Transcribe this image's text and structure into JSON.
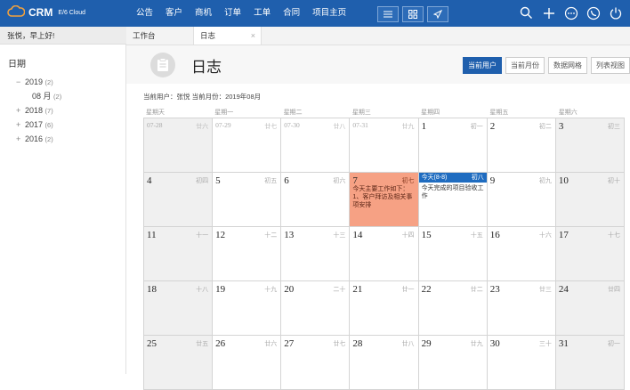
{
  "app": {
    "brand": "CRM",
    "sub": "E/6 Cloud"
  },
  "nav": [
    "公告",
    "客户",
    "商机",
    "订单",
    "工单",
    "合同",
    "项目主页"
  ],
  "greeting": "张悦，早上好!",
  "sidebar": {
    "title": "日期",
    "tree": [
      {
        "toggle": "−",
        "label": "2019",
        "count": "(2)",
        "child": false
      },
      {
        "toggle": "",
        "label": "08 月",
        "count": "(2)",
        "child": true
      },
      {
        "toggle": "+",
        "label": "2018",
        "count": "(7)",
        "child": false
      },
      {
        "toggle": "+",
        "label": "2017",
        "count": "(6)",
        "child": false
      },
      {
        "toggle": "+",
        "label": "2016",
        "count": "(2)",
        "child": false
      }
    ]
  },
  "tabs": {
    "workbench": "工作台",
    "log": "日志",
    "close": "×"
  },
  "page": {
    "title": "日志"
  },
  "view_buttons": [
    "当前用户",
    "当前月份",
    "数据网格",
    "列表视图"
  ],
  "status": "当前用户：张悦  当前月份：2019年08月",
  "weekdays": [
    "星期天",
    "星期一",
    "星期二",
    "星期三",
    "星期四",
    "星期五",
    "星期六"
  ],
  "days": [
    {
      "d": "07-28",
      "l": "廿六",
      "o": true,
      "w": true
    },
    {
      "d": "07-29",
      "l": "廿七",
      "o": true
    },
    {
      "d": "07-30",
      "l": "廿八",
      "o": true
    },
    {
      "d": "07-31",
      "l": "廿九",
      "o": true
    },
    {
      "d": "1",
      "l": "初一"
    },
    {
      "d": "2",
      "l": "初二"
    },
    {
      "d": "3",
      "l": "初三",
      "w": true
    },
    {
      "d": "4",
      "l": "初四",
      "w": true
    },
    {
      "d": "5",
      "l": "初五"
    },
    {
      "d": "6",
      "l": "初六"
    },
    {
      "d": "7",
      "l": "初七",
      "h": true,
      "note": "今天主要工作如下：1、客户拜访及相关事项安排"
    },
    {
      "d": "今天(8-8)",
      "l": "初八",
      "today": true,
      "note": "今天完成的项目验收工作"
    },
    {
      "d": "9",
      "l": "初九"
    },
    {
      "d": "10",
      "l": "初十",
      "w": true
    },
    {
      "d": "11",
      "l": "十一",
      "w": true
    },
    {
      "d": "12",
      "l": "十二"
    },
    {
      "d": "13",
      "l": "十三"
    },
    {
      "d": "14",
      "l": "十四"
    },
    {
      "d": "15",
      "l": "十五"
    },
    {
      "d": "16",
      "l": "十六"
    },
    {
      "d": "17",
      "l": "十七",
      "w": true
    },
    {
      "d": "18",
      "l": "十八",
      "w": true
    },
    {
      "d": "19",
      "l": "十九"
    },
    {
      "d": "20",
      "l": "二十"
    },
    {
      "d": "21",
      "l": "廿一"
    },
    {
      "d": "22",
      "l": "廿二"
    },
    {
      "d": "23",
      "l": "廿三"
    },
    {
      "d": "24",
      "l": "廿四",
      "w": true
    },
    {
      "d": "25",
      "l": "廿五",
      "w": true
    },
    {
      "d": "26",
      "l": "廿六"
    },
    {
      "d": "27",
      "l": "廿七"
    },
    {
      "d": "28",
      "l": "廿八"
    },
    {
      "d": "29",
      "l": "廿九"
    },
    {
      "d": "30",
      "l": "三十"
    },
    {
      "d": "31",
      "l": "初一",
      "w": true
    }
  ],
  "icons": [
    "search-icon",
    "plus-icon",
    "more-icon",
    "phone-icon",
    "power-icon"
  ],
  "colors": {
    "accent": "#1f5fad",
    "highlight": "#f6a184",
    "today": "#1f6cc0"
  }
}
